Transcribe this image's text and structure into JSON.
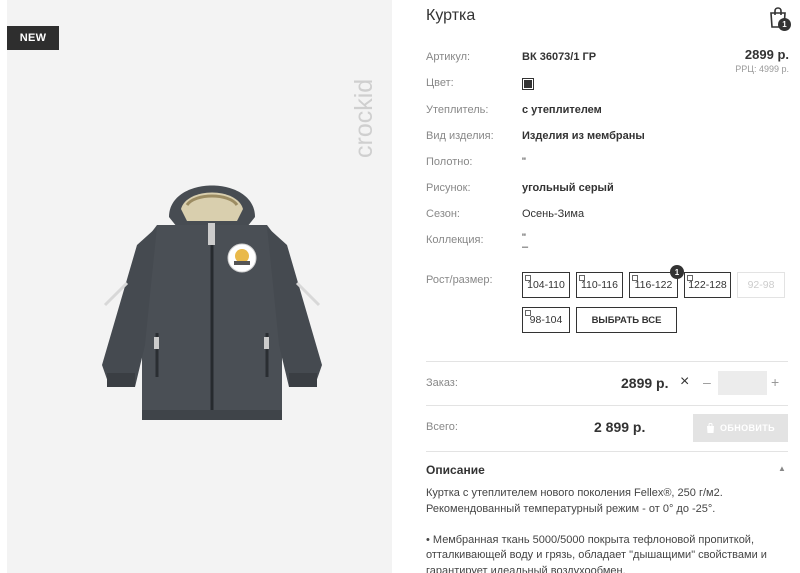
{
  "badge": "NEW",
  "brand": "crockid",
  "product": {
    "title": "Куртка",
    "cart_count": "1",
    "price": "2899 р.",
    "rrp": "РРЦ: 4999 р."
  },
  "attributes": [
    {
      "label": "Артикул:",
      "value": "ВК 36073/1 ГР"
    },
    {
      "label": "Цвет:",
      "value": ""
    },
    {
      "label": "Утеплитель:",
      "value": "с утеплителем"
    },
    {
      "label": "Вид изделия:",
      "value": "Изделия из мембраны"
    },
    {
      "label": "Полотно:",
      "value": "\""
    },
    {
      "label": "Рисунок:",
      "value": "угольный серый"
    },
    {
      "label": "Сезон:",
      "value": "Осень-Зима"
    },
    {
      "label": "Коллекция:",
      "value": "\"",
      "value2": "–"
    }
  ],
  "color_swatch": "#333333",
  "sizes": {
    "label": "Рост/размер:",
    "options": [
      "104-110",
      "110-116",
      "116-122",
      "122-128",
      "92-98",
      "98-104"
    ],
    "selected": "116-122",
    "selected_count": "1",
    "disabled": [
      "92-98"
    ],
    "select_all": "ВЫБРАТЬ ВСЕ"
  },
  "order": {
    "label": "Заказ:",
    "price": "2899 р.",
    "remove_icon": "×",
    "minus": "–",
    "plus": "+",
    "quantity": ""
  },
  "total": {
    "label": "Всего:",
    "price": "2 899 р.",
    "update_button": "ОБНОВИТЬ"
  },
  "description": {
    "title": "Описание",
    "paragraphs": [
      "Куртка с утеплителем нового поколения Fellex®, 250 г/м2. Рекомендованный температурный режим - от 0° до -25°.",
      "• Мембранная ткань 5000/5000 покрыта тефлоновой пропиткой, отталкивающей воду и грязь, обладает \"дышащими\" свойствами и гарантирует идеальный воздухообмен."
    ]
  },
  "colors": {
    "accent": "#333333",
    "muted": "#888888",
    "divider": "#e3e3e3",
    "button_disabled": "#e3e3e3",
    "image_bg": "#f3f3f3"
  }
}
